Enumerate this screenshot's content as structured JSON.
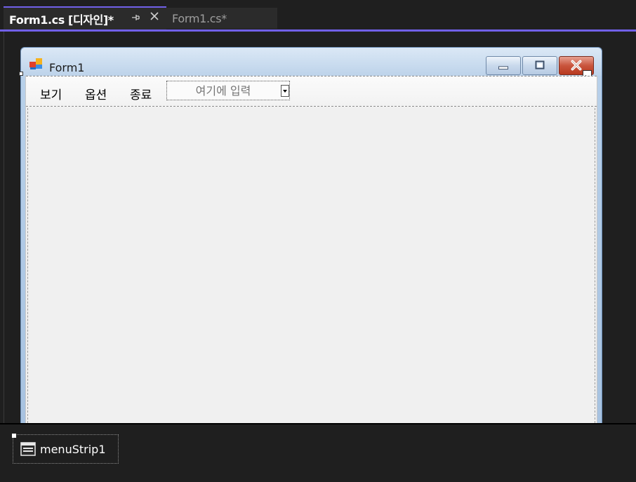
{
  "tabs": [
    {
      "title": "Form1.cs [디자인]*",
      "active": true
    },
    {
      "title": "Form1.cs*",
      "active": false
    }
  ],
  "tab_icons": {
    "pin": "pin-icon",
    "close": "close-icon"
  },
  "form": {
    "title": "Form1",
    "icon": "form-app-icon"
  },
  "menu": {
    "items": [
      "보기",
      "옵션",
      "종료"
    ],
    "combo_placeholder": "여기에 입력"
  },
  "tray": {
    "component": "menuStrip1",
    "icon": "menustrip-icon"
  },
  "colors": {
    "accent": "#7160e8",
    "background": "#1f1f1f",
    "tab_bg": "#2b2b2b",
    "client": "#f0f0f0",
    "close_button": "#c9553d"
  }
}
